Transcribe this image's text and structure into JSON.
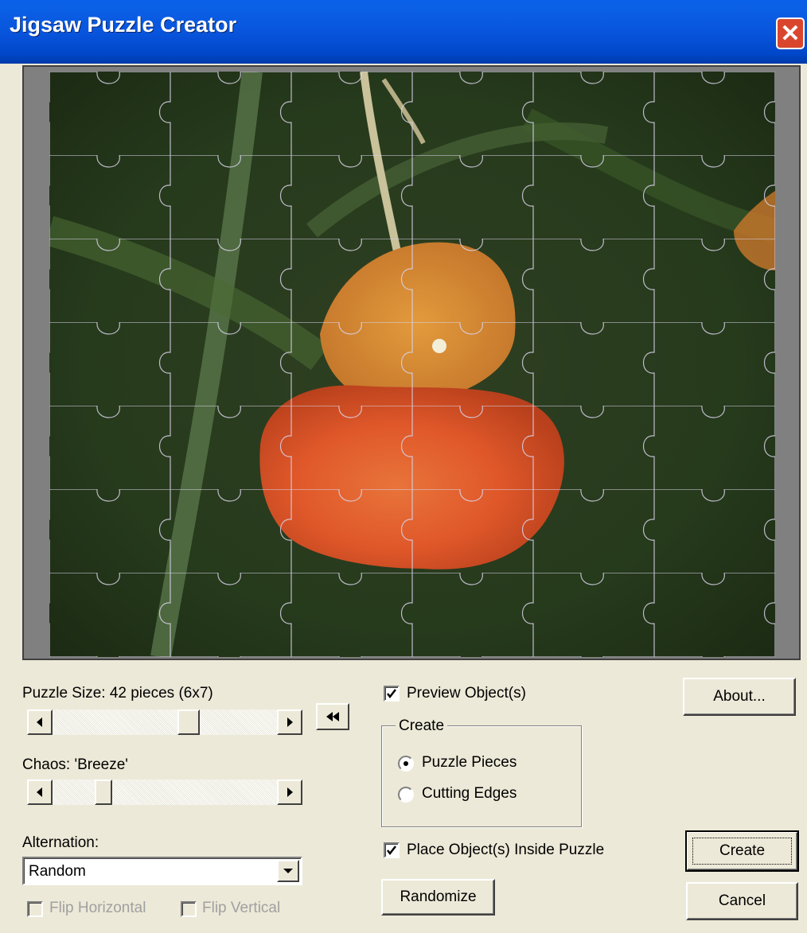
{
  "window": {
    "title": "Jigsaw Puzzle Creator"
  },
  "puzzle_size": {
    "label": "Puzzle Size: 42 pieces (6x7)"
  },
  "chaos": {
    "label": "Chaos: 'Breeze'"
  },
  "alternation": {
    "label": "Alternation:",
    "selected": "Random"
  },
  "flip": {
    "horizontal": "Flip Horizontal",
    "vertical": "Flip Vertical"
  },
  "preview_objects": {
    "label": "Preview Object(s)"
  },
  "create_group": {
    "title": "Create",
    "option_pieces": "Puzzle Pieces",
    "option_edges": "Cutting Edges"
  },
  "place_inside": {
    "label": "Place Object(s) Inside Puzzle"
  },
  "buttons": {
    "about": "About...",
    "randomize": "Randomize",
    "create": "Create",
    "cancel": "Cancel"
  },
  "icons": {
    "close": "close-icon",
    "rewind": "rewind-icon",
    "scroll_left": "scroll-left-arrow-icon",
    "scroll_right": "scroll-right-arrow-icon",
    "dropdown": "chevron-down-icon",
    "checkmark": "checkmark-icon"
  },
  "state": {
    "puzzle_size_slider_fraction": 0.6,
    "chaos_slider_fraction": 0.25,
    "preview_checked": true,
    "place_inside_checked": true,
    "flip_horizontal_checked": false,
    "flip_vertical_checked": false,
    "create_option_selected": "Puzzle Pieces"
  },
  "colors": {
    "title_bar": "#0855dd",
    "dialog_bg": "#ece9d8",
    "close_button": "#d9462d",
    "preview_bg": "#808080"
  }
}
